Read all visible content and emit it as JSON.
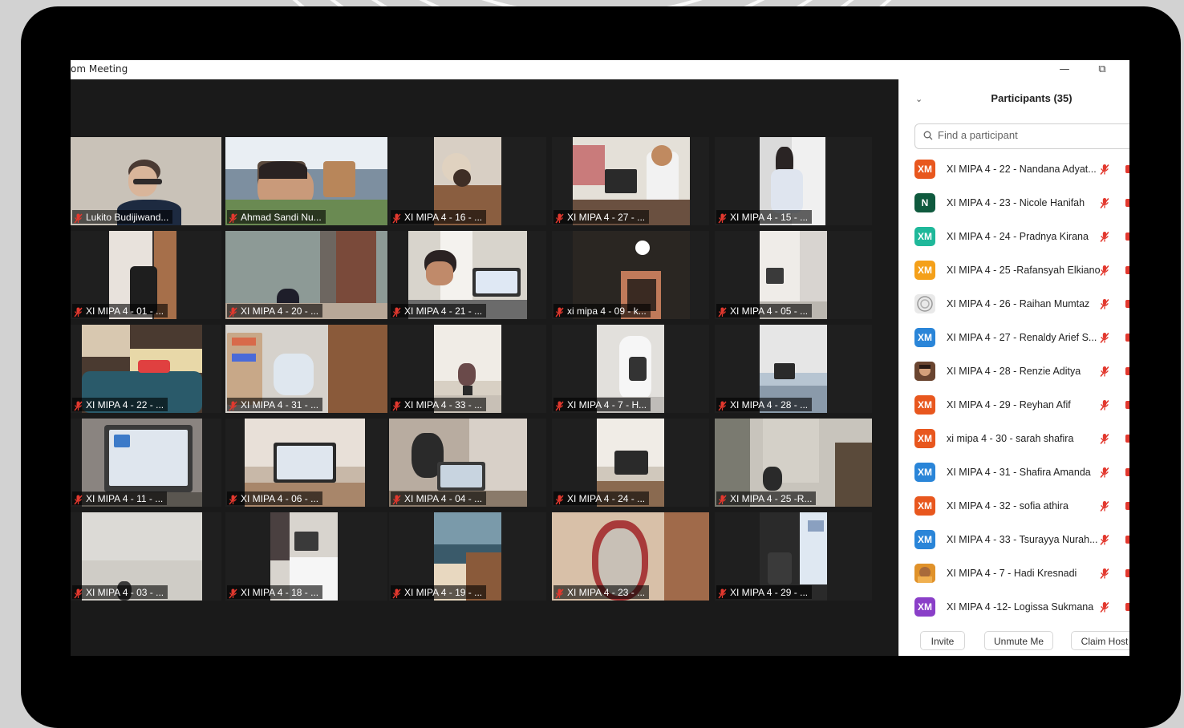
{
  "window": {
    "title": "om Meeting",
    "minimize_glyph": "—",
    "restore_glyph": "⧉"
  },
  "gallery": [
    {
      "label": "Lukito Budijiwand...",
      "muted": true,
      "active": false,
      "scene": "man-glasses"
    },
    {
      "label": "Ahmad Sandi Nu...",
      "muted": true,
      "active": true,
      "scene": "man-virtual-bg"
    },
    {
      "label": "XI MIPA 4 - 16 - ...",
      "muted": true,
      "active": false,
      "scene": "desk-cup"
    },
    {
      "label": "XI MIPA 4 - 27 - ...",
      "muted": true,
      "active": false,
      "scene": "boy-desk"
    },
    {
      "label": "XI MIPA 4 - 15 - ...",
      "muted": true,
      "active": false,
      "scene": "girl-window"
    },
    {
      "label": "XI MIPA 4 - 01 - ...",
      "muted": true,
      "active": false,
      "scene": "chair-room"
    },
    {
      "label": "XI MIPA 4 - 20 - ...",
      "muted": true,
      "active": false,
      "scene": "curtain-room"
    },
    {
      "label": "XI MIPA 4 - 21 - ...",
      "muted": true,
      "active": false,
      "scene": "boy-laptop"
    },
    {
      "label": "xi mipa 4 - 09 - k...",
      "muted": true,
      "active": false,
      "scene": "lamp-room"
    },
    {
      "label": "XI MIPA 4 - 05 - ...",
      "muted": true,
      "active": false,
      "scene": "wall-clock"
    },
    {
      "label": "XI MIPA 4 - 22 - ...",
      "muted": true,
      "active": false,
      "scene": "bed-table"
    },
    {
      "label": "XI MIPA 4 - 31 - ...",
      "muted": true,
      "active": false,
      "scene": "bookshelf"
    },
    {
      "label": "XI MIPA 4 - 33 - ...",
      "muted": true,
      "active": false,
      "scene": "room-chair"
    },
    {
      "label": "XI MIPA 4 - 7 - H...",
      "muted": true,
      "active": false,
      "scene": "white-chair"
    },
    {
      "label": "XI MIPA 4 - 28 - ...",
      "muted": true,
      "active": false,
      "scene": "blue-desk"
    },
    {
      "label": "XI MIPA 4 - 11 - ...",
      "muted": true,
      "active": false,
      "scene": "laptop-screen"
    },
    {
      "label": "XI MIPA 4 - 06 - ...",
      "muted": true,
      "active": false,
      "scene": "laptop-desk"
    },
    {
      "label": "XI MIPA 4 - 04 - ...",
      "muted": true,
      "active": false,
      "scene": "girl-laptop"
    },
    {
      "label": "XI MIPA 4 - 24 - ...",
      "muted": true,
      "active": false,
      "scene": "laptop-corner"
    },
    {
      "label": "XI MIPA 4 - 25 -R...",
      "muted": true,
      "active": false,
      "scene": "curtain-boy"
    },
    {
      "label": "XI MIPA 4 - 03 - ...",
      "muted": true,
      "active": false,
      "scene": "ceiling"
    },
    {
      "label": "XI MIPA 4 - 18 - ...",
      "muted": true,
      "active": false,
      "scene": "white-desk"
    },
    {
      "label": "XI MIPA 4 - 19 - ...",
      "muted": true,
      "active": false,
      "scene": "wood-desk"
    },
    {
      "label": "XI MIPA 4 - 23 - ...",
      "muted": true,
      "active": false,
      "scene": "red-mirror"
    },
    {
      "label": "XI MIPA 4 - 29 - ...",
      "muted": true,
      "active": false,
      "scene": "dark-room"
    }
  ],
  "participants": {
    "title": "Participants (35)",
    "collapse_glyph": "⌄",
    "search": {
      "placeholder": "Find a participant",
      "icon": "search-icon"
    },
    "list": [
      {
        "name": "XI MIPA 4 - 22 - Nandana Adyat...",
        "avatar_text": "XM",
        "avatar_color": "#e8571e",
        "muted": true
      },
      {
        "name": "XI MIPA 4 - 23 - Nicole Hanifah",
        "avatar_text": "N",
        "avatar_color": "#0f5a3e",
        "muted": true
      },
      {
        "name": "XI MIPA 4 - 24 - Pradnya Kirana",
        "avatar_text": "XM",
        "avatar_color": "#1fb89a",
        "muted": true
      },
      {
        "name": "XI MIPA 4 - 25 -Rafansyah Elkiano",
        "avatar_text": "XM",
        "avatar_color": "#f4a01a",
        "muted": true
      },
      {
        "name": "XI MIPA 4 - 26 - Raihan Mumtaz",
        "avatar_text": "",
        "avatar_color": "#e9e9e9",
        "avatar_kind": "photo-gray",
        "muted": true
      },
      {
        "name": "XI MIPA 4 - 27 - Renaldy Arief S...",
        "avatar_text": "XM",
        "avatar_color": "#2a85d8",
        "muted": true
      },
      {
        "name": "XI MIPA 4 - 28 - Renzie Aditya",
        "avatar_text": "",
        "avatar_color": "#8a5a3a",
        "avatar_kind": "photo-face",
        "muted": true
      },
      {
        "name": "XI MIPA 4 - 29 - Reyhan Afif",
        "avatar_text": "XM",
        "avatar_color": "#e8571e",
        "muted": true
      },
      {
        "name": "xi mipa 4 - 30 - sarah shafira",
        "avatar_text": "XM",
        "avatar_color": "#e8571e",
        "muted": true
      },
      {
        "name": "XI MIPA 4 - 31 - Shafira Amanda",
        "avatar_text": "XM",
        "avatar_color": "#2a85d8",
        "muted": true
      },
      {
        "name": "XI MIPA 4 - 32 - sofia athira",
        "avatar_text": "XM",
        "avatar_color": "#e8571e",
        "muted": true
      },
      {
        "name": "XI MIPA 4 - 33 - Tsurayya Nurah...",
        "avatar_text": "XM",
        "avatar_color": "#2a85d8",
        "muted": true
      },
      {
        "name": "XI MIPA 4 - 7 - Hadi Kresnadi",
        "avatar_text": "",
        "avatar_color": "#d8892a",
        "avatar_kind": "photo-orange",
        "muted": true
      },
      {
        "name": "XI MIPA 4 -12- Logissa Sukmana",
        "avatar_text": "XM",
        "avatar_color": "#8a3fc8",
        "muted": true
      }
    ],
    "footer": {
      "invite": "Invite",
      "unmute": "Unmute Me",
      "claim_host": "Claim Host"
    }
  }
}
